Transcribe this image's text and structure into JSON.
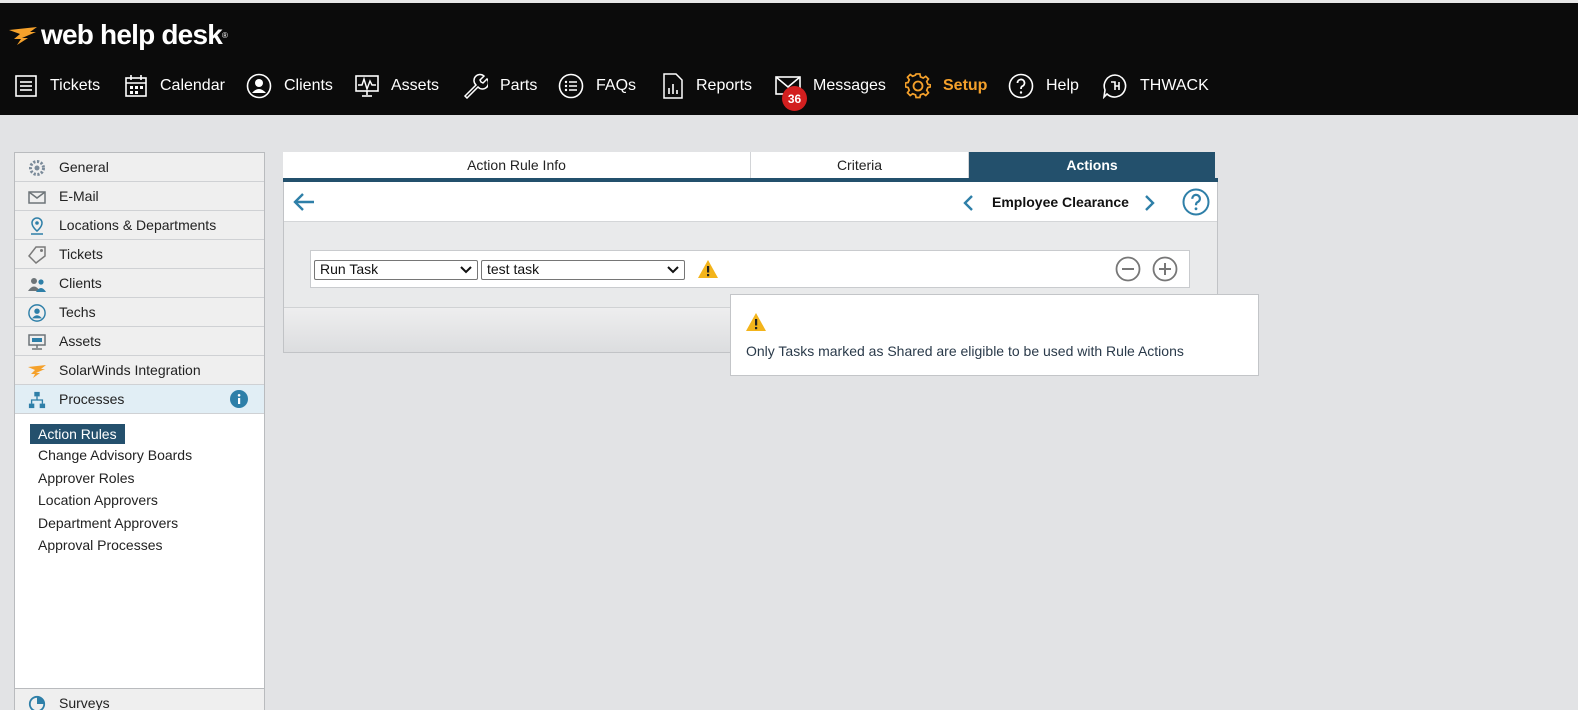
{
  "brand": {
    "name": "web help desk",
    "tm": "®"
  },
  "nav": [
    {
      "label": "Tickets",
      "icon": "tickets-icon"
    },
    {
      "label": "Calendar",
      "icon": "calendar-icon"
    },
    {
      "label": "Clients",
      "icon": "clients-icon"
    },
    {
      "label": "Assets",
      "icon": "assets-icon"
    },
    {
      "label": "Parts",
      "icon": "parts-icon"
    },
    {
      "label": "FAQs",
      "icon": "faqs-icon"
    },
    {
      "label": "Reports",
      "icon": "reports-icon"
    },
    {
      "label": "Messages",
      "icon": "messages-icon",
      "badge": "36"
    },
    {
      "label": "Setup",
      "icon": "setup-icon",
      "active": true
    },
    {
      "label": "Help",
      "icon": "help-icon"
    },
    {
      "label": "THWACK",
      "icon": "thwack-icon"
    }
  ],
  "sidebar": {
    "items": [
      {
        "label": "General",
        "icon": "gear-icon"
      },
      {
        "label": "E-Mail",
        "icon": "envelope-icon"
      },
      {
        "label": "Locations & Departments",
        "icon": "location-pin-icon"
      },
      {
        "label": "Tickets",
        "icon": "ticket-icon"
      },
      {
        "label": "Clients",
        "icon": "users-icon"
      },
      {
        "label": "Techs",
        "icon": "tech-user-icon"
      },
      {
        "label": "Assets",
        "icon": "monitor-icon"
      },
      {
        "label": "SolarWinds Integration",
        "icon": "solarwinds-icon"
      },
      {
        "label": "Processes",
        "icon": "processes-icon",
        "open": true
      }
    ],
    "sub_items": [
      {
        "label": "Action Rules",
        "selected": true
      },
      {
        "label": "Change Advisory Boards"
      },
      {
        "label": "Approver Roles"
      },
      {
        "label": "Location Approvers"
      },
      {
        "label": "Department Approvers"
      },
      {
        "label": "Approval Processes"
      }
    ],
    "bottom_item": {
      "label": "Surveys",
      "icon": "pie-chart-icon"
    }
  },
  "tabs": [
    {
      "label": "Action Rule Info"
    },
    {
      "label": "Criteria"
    },
    {
      "label": "Actions",
      "active": true
    }
  ],
  "rule": {
    "name": "Employee Clearance"
  },
  "action": {
    "type_value": "Run Task",
    "task_value": "test task"
  },
  "tooltip": {
    "message": "Only Tasks marked as Shared are eligible to be used with Rule Actions"
  },
  "colors": {
    "topbar": "#0b0b0b",
    "accent_orange": "#f5a12b",
    "tab_active": "#23506c",
    "badge": "#d21f1f",
    "link_blue": "#2e7fa8",
    "warning": "#f3b41b"
  }
}
